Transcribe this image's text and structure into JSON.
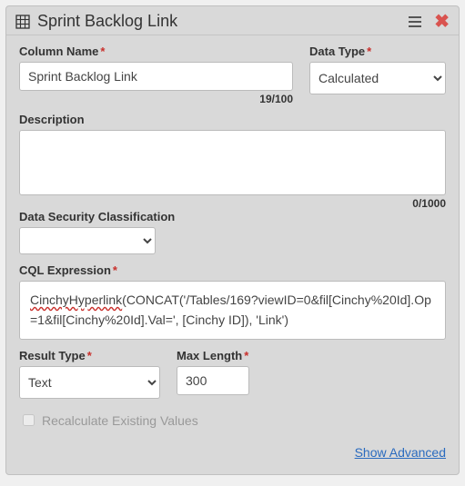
{
  "header": {
    "title": "Sprint Backlog Link"
  },
  "columnName": {
    "label": "Column Name",
    "value": "Sprint Backlog Link",
    "counter": "19/100"
  },
  "dataType": {
    "label": "Data Type",
    "value": "Calculated"
  },
  "description": {
    "label": "Description",
    "value": "",
    "counter": "0/1000"
  },
  "dsc": {
    "label": "Data Security Classification",
    "value": ""
  },
  "cql": {
    "label": "CQL Expression",
    "fn": "CinchyHyperlink",
    "rest": "(CONCAT('/Tables/169?viewID=0&fil[Cinchy%20Id].Op=1&fil[Cinchy%20Id].Val=', [Cinchy ID]), 'Link')"
  },
  "resultType": {
    "label": "Result Type",
    "value": "Text"
  },
  "maxLength": {
    "label": "Max Length",
    "value": "300"
  },
  "recalc": {
    "label": "Recalculate Existing Values"
  },
  "showAdvanced": "Show Advanced"
}
